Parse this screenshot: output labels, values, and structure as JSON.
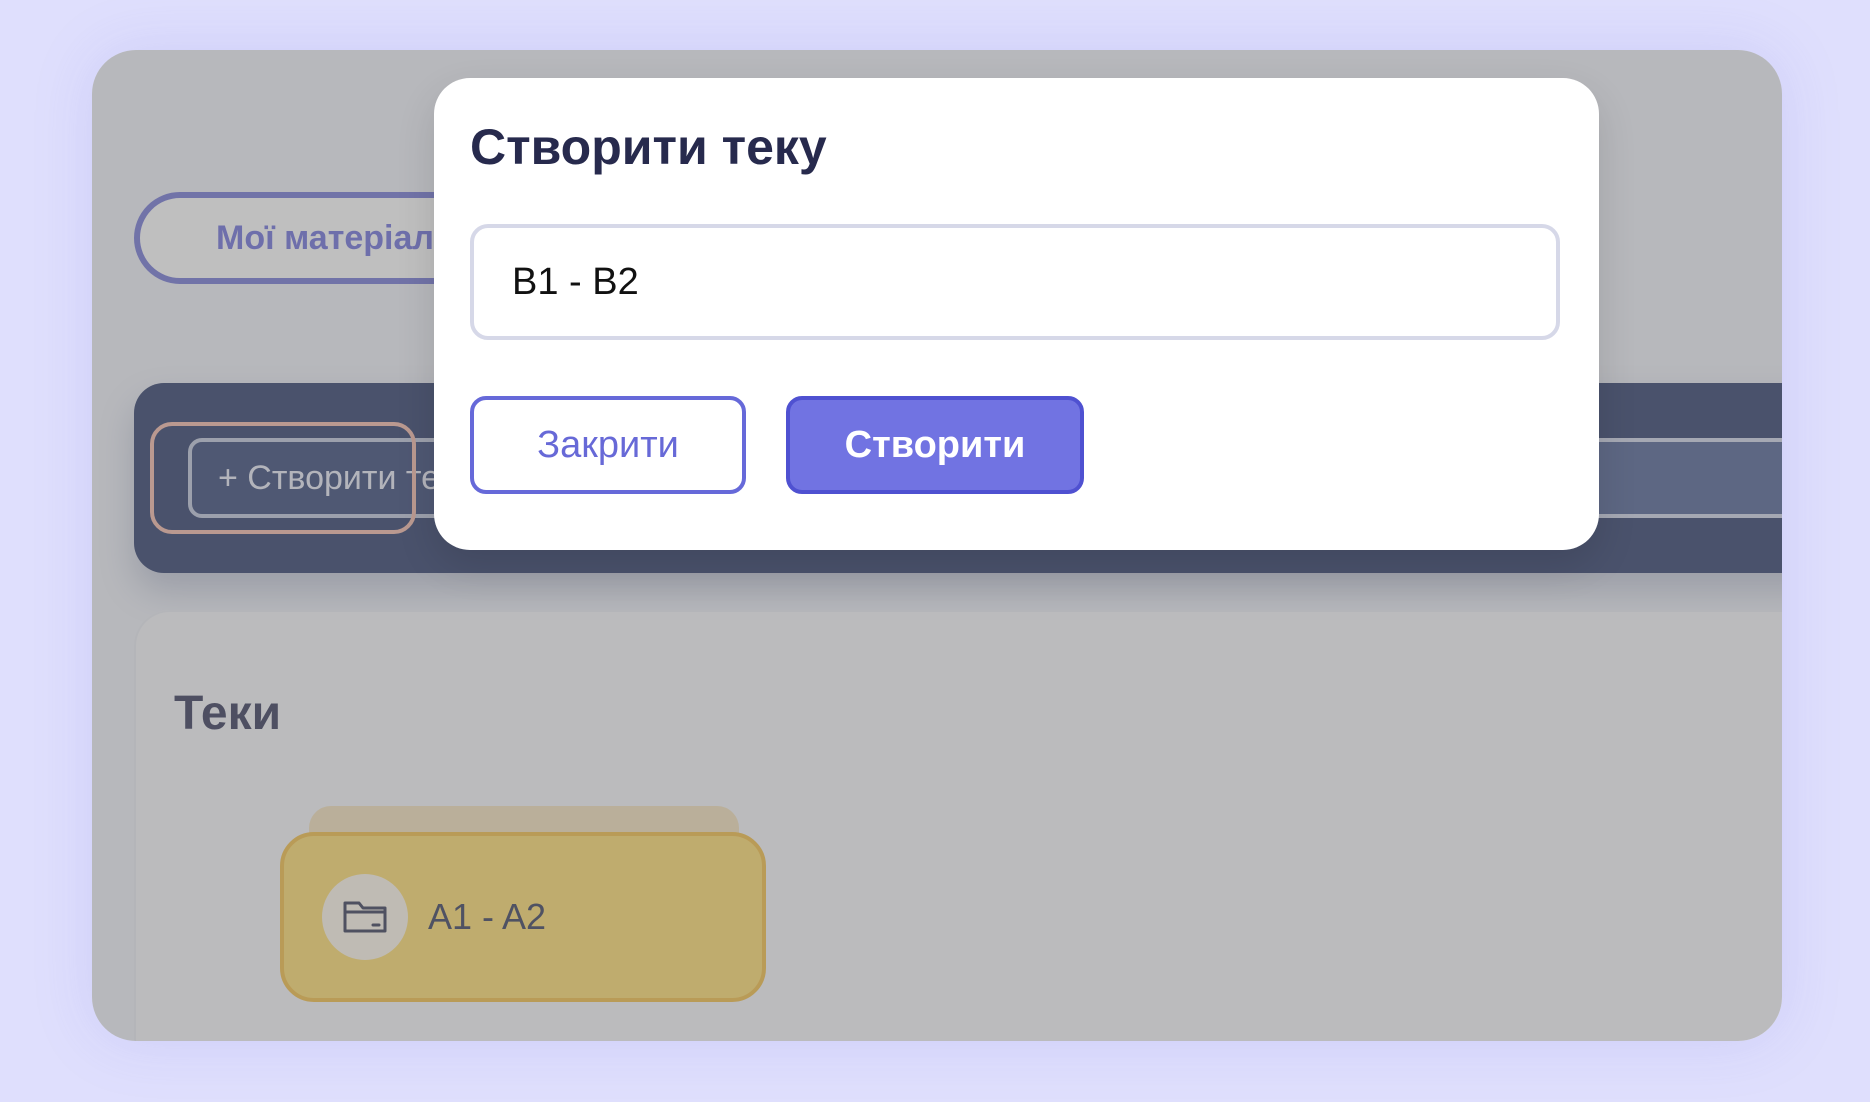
{
  "page": {
    "tab_my_materials": "Мої матеріали",
    "toolbar": {
      "create_folder_button": "+ Створити теку"
    },
    "folders_section": {
      "title": "Теки",
      "items": [
        {
          "label": "A1 - A2",
          "icon": "folder-icon"
        }
      ]
    }
  },
  "modal": {
    "title": "Створити теку",
    "input_value": "B1 - B2",
    "close_label": "Закрити",
    "create_label": "Створити"
  },
  "colors": {
    "accent": "#6366d1",
    "toolbar": "#142458",
    "folder": "#ffd85c"
  }
}
